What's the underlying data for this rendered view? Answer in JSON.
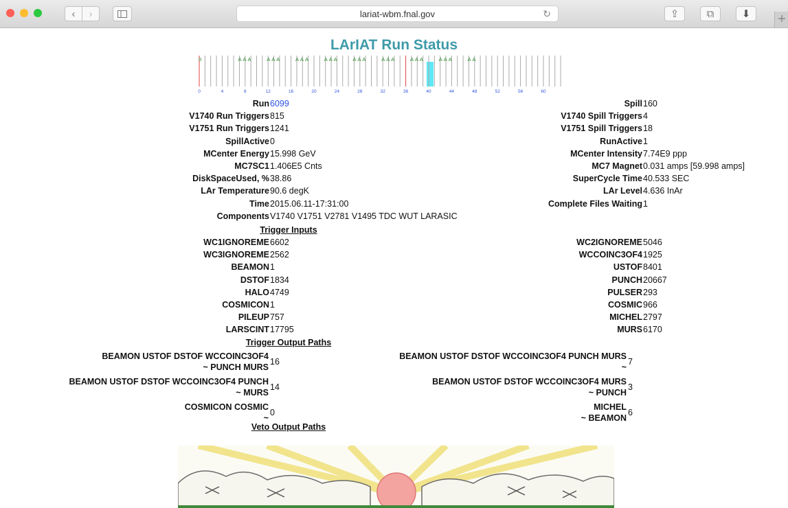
{
  "browser": {
    "url": "lariat-wbm.fnal.gov",
    "back_glyph": "‹",
    "forward_glyph": "›",
    "reload_glyph": "↻",
    "share_glyph": "⇪",
    "tabs_glyph": "⧉",
    "download_glyph": "⬇",
    "new_tab_glyph": "+"
  },
  "page": {
    "title": "LArIAT Run Status",
    "title_color": "#3e9aa9",
    "run_bar": {
      "first_label": "0",
      "group_label": "AAA",
      "tick_labels": [
        "0",
        "4",
        "8",
        "12",
        "16",
        "20",
        "24",
        "28",
        "32",
        "36",
        "40",
        "44",
        "48",
        "52",
        "56",
        "60"
      ],
      "highlight_index": 40,
      "highlight_color": "#5fe8f5"
    },
    "left_fields": [
      {
        "label": "Run",
        "value": "6099"
      },
      {
        "label": "V1740 Run Triggers",
        "value": "815"
      },
      {
        "label": "V1751 Run Triggers",
        "value": "1241"
      },
      {
        "label": "SpillActive",
        "value": "0"
      },
      {
        "label": "MCenter Energy",
        "value": "15.998 GeV"
      },
      {
        "label": "MC7SC1",
        "value": "1.406E5 Cnts"
      },
      {
        "label": "DiskSpaceUsed, %",
        "value": "38.86"
      },
      {
        "label": "LAr Temperature",
        "value": "90.6 degK"
      },
      {
        "label": "Time",
        "value": "2015.06.11-17:31:00"
      },
      {
        "label": "Components",
        "value": "V1740 V1751 V2781 V1495 TDC WUT LARASIC"
      }
    ],
    "right_fields": [
      {
        "label": "Spill",
        "value": "160"
      },
      {
        "label": "V1740 Spill Triggers",
        "value": "4"
      },
      {
        "label": "V1751 Spill Triggers",
        "value": "18"
      },
      {
        "label": "RunActive",
        "value": "1"
      },
      {
        "label": "MCenter Intensity",
        "value": "7.74E9 ppp"
      },
      {
        "label": "MC7 Magnet",
        "value": "0.031 amps [59.998 amps]"
      },
      {
        "label": "SuperCycle Time",
        "value": "40.533 SEC"
      },
      {
        "label": "LAr Level",
        "value": "4.636 InAr"
      },
      {
        "label": "Complete Files Waiting",
        "value": "1"
      }
    ],
    "trigger_inputs_heading": "Trigger Inputs",
    "trigger_left": [
      {
        "label": "WC1IGNOREME",
        "value": "6602"
      },
      {
        "label": "WC3IGNOREME",
        "value": "2562"
      },
      {
        "label": "BEAMON",
        "value": "1"
      },
      {
        "label": "DSTOF",
        "value": "1834"
      },
      {
        "label": "HALO",
        "value": "4749"
      },
      {
        "label": "COSMICON",
        "value": "1"
      },
      {
        "label": "PILEUP",
        "value": "757"
      },
      {
        "label": "LARSCINT",
        "value": "17795"
      }
    ],
    "trigger_right": [
      {
        "label": "WC2IGNOREME",
        "value": "5046"
      },
      {
        "label": "WCCOINC3OF4",
        "value": "1925"
      },
      {
        "label": "USTOF",
        "value": "8401"
      },
      {
        "label": "PUNCH",
        "value": "20667"
      },
      {
        "label": "PULSER",
        "value": "293"
      },
      {
        "label": "COSMIC",
        "value": "966"
      },
      {
        "label": "MICHEL",
        "value": "2797"
      },
      {
        "label": "MURS",
        "value": "6170"
      }
    ],
    "trigger_output_heading": "Trigger Output Paths",
    "output_left": [
      {
        "line1": "BEAMON USTOF DSTOF WCCOINC3OF4",
        "line2": "~ PUNCH MURS",
        "value": "16"
      },
      {
        "line1": "BEAMON USTOF DSTOF WCCOINC3OF4 PUNCH",
        "line2": "~ MURS",
        "value": "14"
      },
      {
        "line1": "COSMICON COSMIC",
        "line2": "~",
        "value": "0"
      }
    ],
    "output_right": [
      {
        "line1": "BEAMON USTOF DSTOF WCCOINC3OF4 PUNCH MURS",
        "line2": "~",
        "value": "7"
      },
      {
        "line1": "BEAMON USTOF DSTOF WCCOINC3OF4 MURS",
        "line2": "~ PUNCH",
        "value": "3"
      },
      {
        "line1": "MICHEL",
        "line2": "~ BEAMON",
        "value": "6"
      }
    ],
    "veto_output_heading": "Veto Output Paths"
  }
}
